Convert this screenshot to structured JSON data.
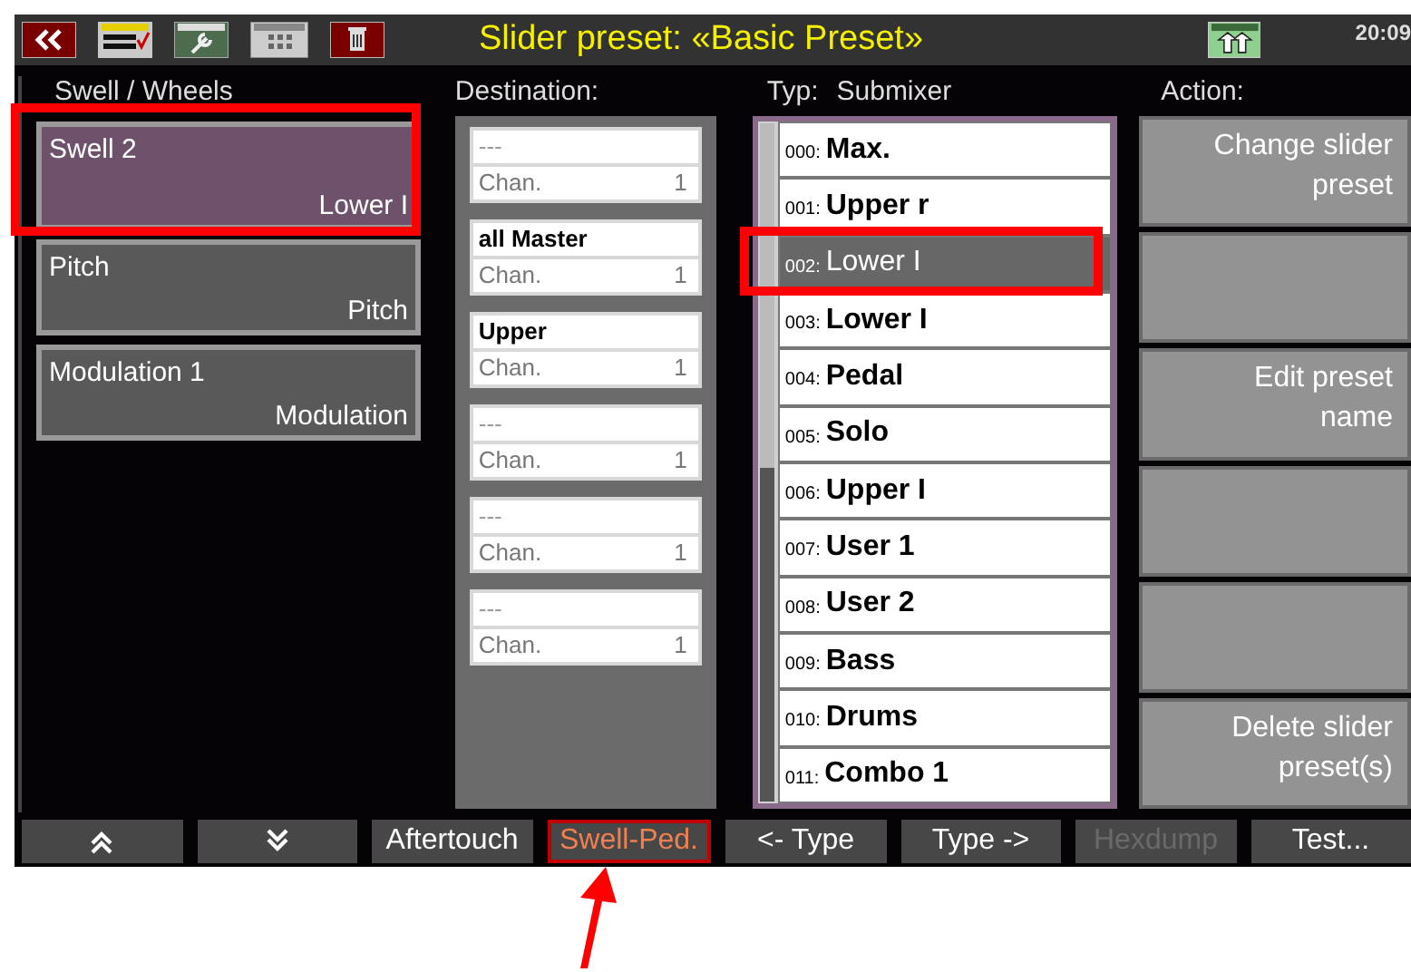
{
  "header": {
    "title": "Slider preset: «Basic Preset»",
    "time": "20:09"
  },
  "columns": {
    "wheels": "Swell / Wheels",
    "destination": "Destination:",
    "type_label": "Typ:",
    "type_value": "Submixer",
    "action": "Action:"
  },
  "controllers": [
    {
      "name": "Swell 2",
      "value": "Lower I",
      "selected": true
    },
    {
      "name": "Pitch",
      "value": "Pitch",
      "selected": false
    },
    {
      "name": "Modulation 1",
      "value": "Modulation",
      "selected": false
    }
  ],
  "destinations": [
    {
      "placeholder": "---",
      "channel_label": "Chan.",
      "channel": "1"
    },
    {
      "value": "all Master",
      "channel_label": "Chan.",
      "channel": "1"
    },
    {
      "value": "Upper",
      "channel_label": "Chan.",
      "channel": "1"
    },
    {
      "placeholder": "---",
      "channel_label": "Chan.",
      "channel": "1"
    },
    {
      "placeholder": "---",
      "channel_label": "Chan.",
      "channel": "1"
    },
    {
      "placeholder": "---",
      "channel_label": "Chan.",
      "channel": "1"
    }
  ],
  "types": [
    {
      "number": "000:",
      "name": "Max.",
      "selected": false
    },
    {
      "number": "001:",
      "name": "Upper r",
      "selected": false
    },
    {
      "number": "002:",
      "name": "Lower I",
      "selected": true
    },
    {
      "number": "003:",
      "name": "Lower I",
      "selected": false
    },
    {
      "number": "004:",
      "name": "Pedal",
      "selected": false
    },
    {
      "number": "005:",
      "name": "Solo",
      "selected": false
    },
    {
      "number": "006:",
      "name": "Upper I",
      "selected": false
    },
    {
      "number": "007:",
      "name": "User 1",
      "selected": false
    },
    {
      "number": "008:",
      "name": "User 2",
      "selected": false
    },
    {
      "number": "009:",
      "name": "Bass",
      "selected": false
    },
    {
      "number": "010:",
      "name": "Drums",
      "selected": false
    },
    {
      "number": "011:",
      "name": "Combo 1",
      "selected": false
    }
  ],
  "actions": [
    {
      "kind": "labeled",
      "label": "Change slider preset"
    },
    {
      "kind": "blank"
    },
    {
      "kind": "labeled",
      "label": "Edit preset name"
    },
    {
      "kind": "blank"
    },
    {
      "kind": "blank"
    },
    {
      "kind": "labeled",
      "label": "Delete slider preset(s)"
    }
  ],
  "softkeys": [
    {
      "kind": "up",
      "selected": false,
      "disabled": false
    },
    {
      "kind": "down",
      "selected": false,
      "disabled": false
    },
    {
      "kind": "text",
      "label": "Aftertouch",
      "selected": false,
      "disabled": false
    },
    {
      "kind": "text",
      "label": "Swell-Ped.",
      "selected": true,
      "disabled": false
    },
    {
      "kind": "text",
      "label": "<- Type",
      "selected": false,
      "disabled": false
    },
    {
      "kind": "text",
      "label": "Type ->",
      "selected": false,
      "disabled": false
    },
    {
      "kind": "text",
      "label": "Hexdump",
      "selected": false,
      "disabled": true
    },
    {
      "kind": "text",
      "label": "Test...",
      "selected": false,
      "disabled": false
    }
  ]
}
